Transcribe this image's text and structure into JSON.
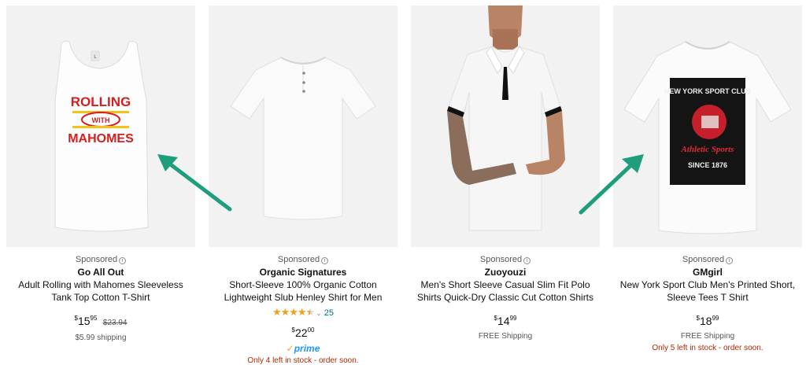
{
  "products": [
    {
      "sponsored": "Sponsored",
      "brand": "Go All Out",
      "title": "Adult Rolling with Mahomes Sleeveless Tank Top Cotton T-Shirt",
      "price_whole": "15",
      "price_cents": "95",
      "was_price": "$23.94",
      "shipping": "$5.99 shipping",
      "shirt_print": [
        "ROLLING",
        "WITH",
        "MAHOMES"
      ],
      "size_tag": "L"
    },
    {
      "sponsored": "Sponsored",
      "brand": "Organic Signatures",
      "title": "Short-Sleeve 100% Organic Cotton Lightweight Slub Henley Shirt for Men",
      "rating_value": 4.5,
      "rating_count": "25",
      "price_whole": "22",
      "price_cents": "00",
      "prime": "prime",
      "stock": "Only 4 left in stock - order soon."
    },
    {
      "sponsored": "Sponsored",
      "brand": "Zuoyouzi",
      "title": "Men's Short Sleeve Casual Slim Fit Polo Shirts Quick-Dry Classic Cut Cotton Shirts",
      "price_whole": "14",
      "price_cents": "99",
      "shipping": "FREE Shipping"
    },
    {
      "sponsored": "Sponsored",
      "brand": "GMgirl",
      "title": "New York Sport Club Men's Printed Short, Sleeve Tees T Shirt",
      "price_whole": "18",
      "price_cents": "99",
      "shipping": "FREE Shipping",
      "stock": "Only 5 left in stock - order soon.",
      "shirt_print": [
        "NEW YORK SPORT CLUB",
        "Athletic Sports",
        "SINCE 1876"
      ]
    }
  ],
  "colors": {
    "arrow": "#1f9e7d",
    "link": "#007185",
    "stock": "#b12704",
    "star": "#f0a01a",
    "prime": "#1a98ff"
  }
}
